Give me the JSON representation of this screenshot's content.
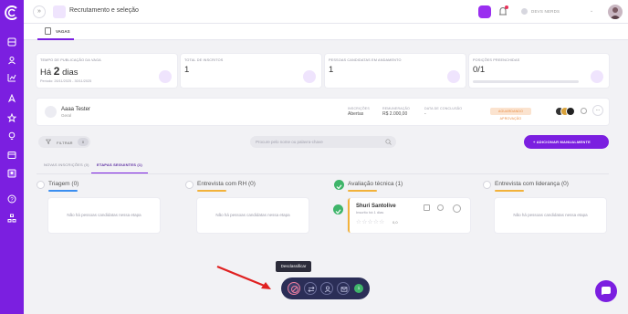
{
  "topbar": {
    "module_title": "Recrutamento e seleção",
    "user_name": "DEVS NERDS"
  },
  "tabs": {
    "vagas": "VAGAS"
  },
  "stats": [
    {
      "label": "TEMPO DE PUBLICAÇÃO DA VAGA",
      "prefix": "Há",
      "value": "2",
      "suffix": "dias",
      "sub": "Período: 26/11/2025 - 30/11/2025",
      "icon": "calendar-icon"
    },
    {
      "label": "TOTAL DE INSCRITOS",
      "value": "1",
      "icon": "users-icon"
    },
    {
      "label": "PESSOAS CANDIDATAS EM ANDAMENTO",
      "value": "1",
      "icon": "refresh-icon"
    },
    {
      "label": "POSIÇÕES PREENCHIDAS",
      "value": "0/1",
      "progress": 0,
      "icon": "team-icon"
    }
  ],
  "job": {
    "title": "Aaaa Tester",
    "subtitle": "Geral",
    "inscricoes_label": "INSCRIÇÕES",
    "inscricoes_value": "Abertas",
    "remuneracao_label": "REMUNERAÇÃO",
    "remuneracao_value": "R$ 2.000,00",
    "conclusao_label": "DATA DE CONCLUSÃO",
    "conclusao_value": "-",
    "status": "AGUARDANDO APROVAÇÃO",
    "more_label": "..."
  },
  "toolbar": {
    "filter_label": "FILTRAR",
    "filter_count": "0",
    "search_placeholder": "Procure pelo nome ou palavra-chave",
    "add_label": "+ ADICIONAR MANUALMENTE"
  },
  "stage_tabs": [
    {
      "label": "NOVAS INSCRIÇÕES (0)"
    },
    {
      "label": "ETAPAS SEGUINTES (1)"
    }
  ],
  "columns": [
    {
      "title": "Triagem (0)",
      "color": "#3b8ef0",
      "empty": "Não há pessoas candidatas nessa etapa"
    },
    {
      "title": "Entrevista com RH (0)",
      "color": "#f2b23b",
      "empty": "Não há pessoas candidatas nessa etapa"
    },
    {
      "title": "Avaliação técnica (1)",
      "color": "#f2b23b"
    },
    {
      "title": "Entrevista com liderança (0)",
      "color": "#f2b23b",
      "empty": "Não há pessoas candidatas nessa etapa"
    }
  ],
  "candidate": {
    "name": "Shuri Santolive",
    "sub": "Inscrito há 1 dias",
    "stars": "☆☆☆☆☆",
    "rating": "0,0"
  },
  "tooltip": "Desclassificar",
  "action_bar": {
    "count": "1"
  }
}
